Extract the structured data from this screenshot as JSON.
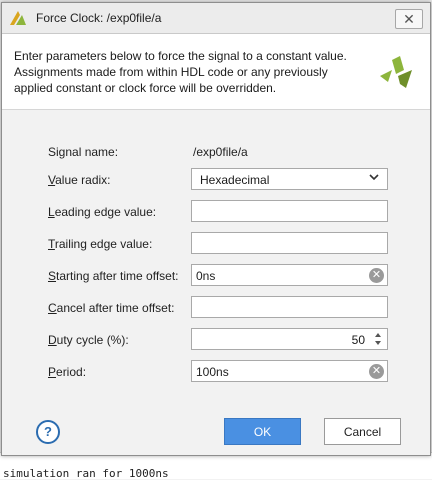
{
  "dialog": {
    "title": "Force Clock:  /exp0file/a",
    "description": "Enter parameters below to force the signal to a constant value. Assignments made from within HDL code or any previously applied constant or clock force will be overridden."
  },
  "fields": {
    "signal_name": {
      "label": "Signal name:",
      "value": "/exp0file/a"
    },
    "value_radix": {
      "label_pre": "",
      "label_ul": "V",
      "label_post": "alue radix:",
      "value": "Hexadecimal"
    },
    "leading_edge": {
      "label_pre": "",
      "label_ul": "L",
      "label_post": "eading edge value:",
      "value": ""
    },
    "trailing_edge": {
      "label_pre": "",
      "label_ul": "T",
      "label_post": "railing edge value:",
      "value": ""
    },
    "start_offset": {
      "label_pre": "",
      "label_ul": "S",
      "label_post": "tarting after time offset:",
      "value": "0ns"
    },
    "cancel_offset": {
      "label_pre": "",
      "label_ul": "C",
      "label_post": "ancel after time offset:",
      "value": ""
    },
    "duty_cycle": {
      "label_pre": "",
      "label_ul": "D",
      "label_post": "uty cycle (%):",
      "value": "50"
    },
    "period": {
      "label_pre": "",
      "label_ul": "P",
      "label_post": "eriod:",
      "value": "100ns"
    }
  },
  "buttons": {
    "help": "?",
    "ok": "OK",
    "cancel": "Cancel",
    "close": "✕"
  },
  "console": {
    "line": "simulation ran for 1000ns"
  },
  "colors": {
    "accent": "#4a90e2",
    "logo": "#8db53c"
  }
}
